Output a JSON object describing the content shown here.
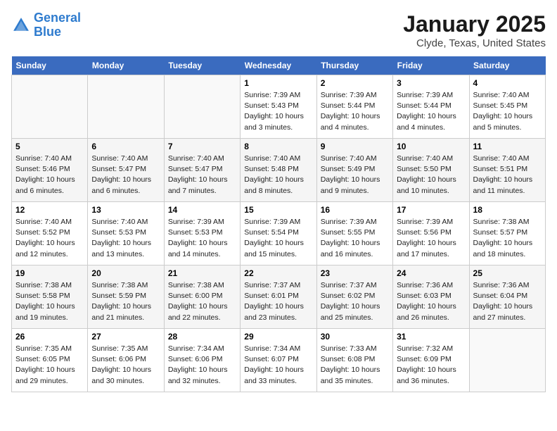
{
  "header": {
    "logo_line1": "General",
    "logo_line2": "Blue",
    "title": "January 2025",
    "subtitle": "Clyde, Texas, United States"
  },
  "weekdays": [
    "Sunday",
    "Monday",
    "Tuesday",
    "Wednesday",
    "Thursday",
    "Friday",
    "Saturday"
  ],
  "weeks": [
    [
      {
        "day": "",
        "sunrise": "",
        "sunset": "",
        "daylight": ""
      },
      {
        "day": "",
        "sunrise": "",
        "sunset": "",
        "daylight": ""
      },
      {
        "day": "",
        "sunrise": "",
        "sunset": "",
        "daylight": ""
      },
      {
        "day": "1",
        "sunrise": "Sunrise: 7:39 AM",
        "sunset": "Sunset: 5:43 PM",
        "daylight": "Daylight: 10 hours and 3 minutes."
      },
      {
        "day": "2",
        "sunrise": "Sunrise: 7:39 AM",
        "sunset": "Sunset: 5:44 PM",
        "daylight": "Daylight: 10 hours and 4 minutes."
      },
      {
        "day": "3",
        "sunrise": "Sunrise: 7:39 AM",
        "sunset": "Sunset: 5:44 PM",
        "daylight": "Daylight: 10 hours and 4 minutes."
      },
      {
        "day": "4",
        "sunrise": "Sunrise: 7:40 AM",
        "sunset": "Sunset: 5:45 PM",
        "daylight": "Daylight: 10 hours and 5 minutes."
      }
    ],
    [
      {
        "day": "5",
        "sunrise": "Sunrise: 7:40 AM",
        "sunset": "Sunset: 5:46 PM",
        "daylight": "Daylight: 10 hours and 6 minutes."
      },
      {
        "day": "6",
        "sunrise": "Sunrise: 7:40 AM",
        "sunset": "Sunset: 5:47 PM",
        "daylight": "Daylight: 10 hours and 6 minutes."
      },
      {
        "day": "7",
        "sunrise": "Sunrise: 7:40 AM",
        "sunset": "Sunset: 5:47 PM",
        "daylight": "Daylight: 10 hours and 7 minutes."
      },
      {
        "day": "8",
        "sunrise": "Sunrise: 7:40 AM",
        "sunset": "Sunset: 5:48 PM",
        "daylight": "Daylight: 10 hours and 8 minutes."
      },
      {
        "day": "9",
        "sunrise": "Sunrise: 7:40 AM",
        "sunset": "Sunset: 5:49 PM",
        "daylight": "Daylight: 10 hours and 9 minutes."
      },
      {
        "day": "10",
        "sunrise": "Sunrise: 7:40 AM",
        "sunset": "Sunset: 5:50 PM",
        "daylight": "Daylight: 10 hours and 10 minutes."
      },
      {
        "day": "11",
        "sunrise": "Sunrise: 7:40 AM",
        "sunset": "Sunset: 5:51 PM",
        "daylight": "Daylight: 10 hours and 11 minutes."
      }
    ],
    [
      {
        "day": "12",
        "sunrise": "Sunrise: 7:40 AM",
        "sunset": "Sunset: 5:52 PM",
        "daylight": "Daylight: 10 hours and 12 minutes."
      },
      {
        "day": "13",
        "sunrise": "Sunrise: 7:40 AM",
        "sunset": "Sunset: 5:53 PM",
        "daylight": "Daylight: 10 hours and 13 minutes."
      },
      {
        "day": "14",
        "sunrise": "Sunrise: 7:39 AM",
        "sunset": "Sunset: 5:53 PM",
        "daylight": "Daylight: 10 hours and 14 minutes."
      },
      {
        "day": "15",
        "sunrise": "Sunrise: 7:39 AM",
        "sunset": "Sunset: 5:54 PM",
        "daylight": "Daylight: 10 hours and 15 minutes."
      },
      {
        "day": "16",
        "sunrise": "Sunrise: 7:39 AM",
        "sunset": "Sunset: 5:55 PM",
        "daylight": "Daylight: 10 hours and 16 minutes."
      },
      {
        "day": "17",
        "sunrise": "Sunrise: 7:39 AM",
        "sunset": "Sunset: 5:56 PM",
        "daylight": "Daylight: 10 hours and 17 minutes."
      },
      {
        "day": "18",
        "sunrise": "Sunrise: 7:38 AM",
        "sunset": "Sunset: 5:57 PM",
        "daylight": "Daylight: 10 hours and 18 minutes."
      }
    ],
    [
      {
        "day": "19",
        "sunrise": "Sunrise: 7:38 AM",
        "sunset": "Sunset: 5:58 PM",
        "daylight": "Daylight: 10 hours and 19 minutes."
      },
      {
        "day": "20",
        "sunrise": "Sunrise: 7:38 AM",
        "sunset": "Sunset: 5:59 PM",
        "daylight": "Daylight: 10 hours and 21 minutes."
      },
      {
        "day": "21",
        "sunrise": "Sunrise: 7:38 AM",
        "sunset": "Sunset: 6:00 PM",
        "daylight": "Daylight: 10 hours and 22 minutes."
      },
      {
        "day": "22",
        "sunrise": "Sunrise: 7:37 AM",
        "sunset": "Sunset: 6:01 PM",
        "daylight": "Daylight: 10 hours and 23 minutes."
      },
      {
        "day": "23",
        "sunrise": "Sunrise: 7:37 AM",
        "sunset": "Sunset: 6:02 PM",
        "daylight": "Daylight: 10 hours and 25 minutes."
      },
      {
        "day": "24",
        "sunrise": "Sunrise: 7:36 AM",
        "sunset": "Sunset: 6:03 PM",
        "daylight": "Daylight: 10 hours and 26 minutes."
      },
      {
        "day": "25",
        "sunrise": "Sunrise: 7:36 AM",
        "sunset": "Sunset: 6:04 PM",
        "daylight": "Daylight: 10 hours and 27 minutes."
      }
    ],
    [
      {
        "day": "26",
        "sunrise": "Sunrise: 7:35 AM",
        "sunset": "Sunset: 6:05 PM",
        "daylight": "Daylight: 10 hours and 29 minutes."
      },
      {
        "day": "27",
        "sunrise": "Sunrise: 7:35 AM",
        "sunset": "Sunset: 6:06 PM",
        "daylight": "Daylight: 10 hours and 30 minutes."
      },
      {
        "day": "28",
        "sunrise": "Sunrise: 7:34 AM",
        "sunset": "Sunset: 6:06 PM",
        "daylight": "Daylight: 10 hours and 32 minutes."
      },
      {
        "day": "29",
        "sunrise": "Sunrise: 7:34 AM",
        "sunset": "Sunset: 6:07 PM",
        "daylight": "Daylight: 10 hours and 33 minutes."
      },
      {
        "day": "30",
        "sunrise": "Sunrise: 7:33 AM",
        "sunset": "Sunset: 6:08 PM",
        "daylight": "Daylight: 10 hours and 35 minutes."
      },
      {
        "day": "31",
        "sunrise": "Sunrise: 7:32 AM",
        "sunset": "Sunset: 6:09 PM",
        "daylight": "Daylight: 10 hours and 36 minutes."
      },
      {
        "day": "",
        "sunrise": "",
        "sunset": "",
        "daylight": ""
      }
    ]
  ]
}
